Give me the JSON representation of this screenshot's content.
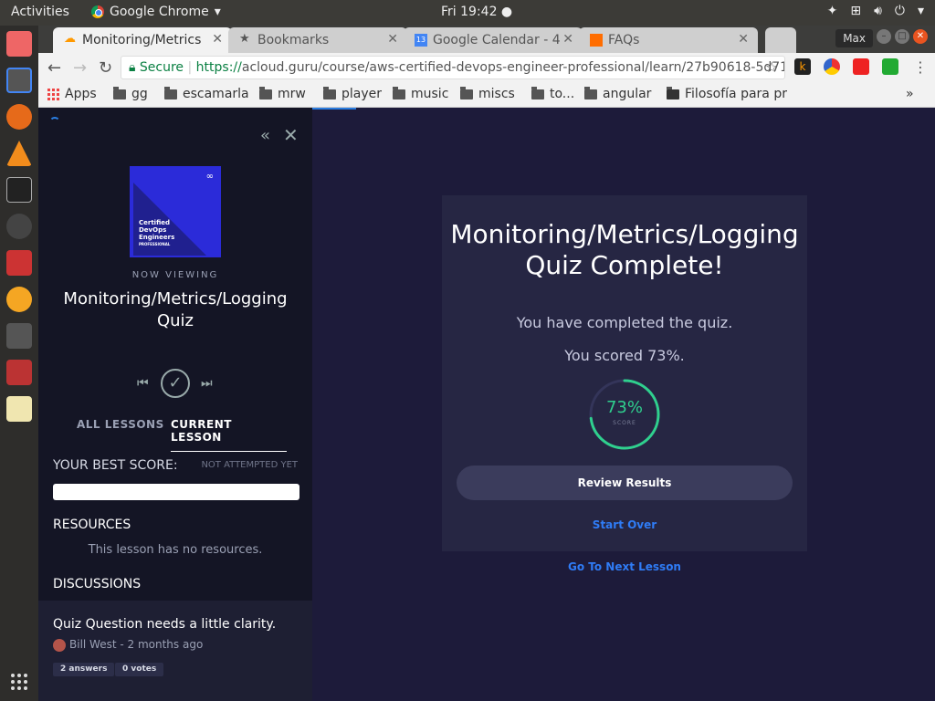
{
  "system": {
    "activities": "Activities",
    "app_name": "Google Chrome",
    "clock": "Fri 19:42"
  },
  "tabs": [
    {
      "label": "Monitoring/Metrics",
      "icon": "cloud-icon",
      "color": "#ff9900"
    },
    {
      "label": "Bookmarks",
      "icon": "star-icon",
      "color": "#555555"
    },
    {
      "label": "Google Calendar - 4",
      "icon": "calendar-icon",
      "color": "#4285f4"
    },
    {
      "label": "FAQs",
      "icon": "cube-icon",
      "color": "#ff6d00"
    }
  ],
  "window": {
    "max_label": "Max"
  },
  "address": {
    "secure": "Secure",
    "scheme": "https://",
    "url": "acloud.guru/course/aws-certified-devops-engineer-professional/learn/27b90618-5d71-..."
  },
  "bookmarks": [
    "Apps",
    "gg",
    "escamarla",
    "mrw",
    "player",
    "music",
    "miscs",
    "to...",
    "angular",
    "Filosofía para pr"
  ],
  "sidebar": {
    "course_thumb": {
      "line1": "Certified",
      "line2": "DevOps",
      "line3": "Engineers",
      "line4": "PROFESSIONAL"
    },
    "now_viewing": "NOW VIEWING",
    "lesson_title_1": "Monitoring/Metrics/Logging",
    "lesson_title_2": "Quiz",
    "tab_all": "ALL LESSONS",
    "tab_current": "CURRENT LESSON",
    "best_score_label": "YOUR BEST SCORE:",
    "best_score_status": "NOT ATTEMPTED YET",
    "resources_label": "RESOURCES",
    "resources_empty": "This lesson has no resources.",
    "discussions_label": "DISCUSSIONS",
    "discussion": {
      "title": "Quiz Question needs a little clarity.",
      "meta": "Bill West - 2 months ago",
      "answers": "2 answers",
      "votes": "0 votes"
    }
  },
  "quiz": {
    "title_1": "Monitoring/Metrics/Logging",
    "title_2": "Quiz Complete!",
    "completed_text": "You have completed the quiz.",
    "score_text": "You scored 73%.",
    "score_pct": "73%",
    "score_value": 0.73,
    "score_label": "SCORE",
    "review_label": "Review Results",
    "start_over_label": "Start Over",
    "next_lesson_label": "Go To Next Lesson",
    "ring_color": "#2fd08e"
  }
}
